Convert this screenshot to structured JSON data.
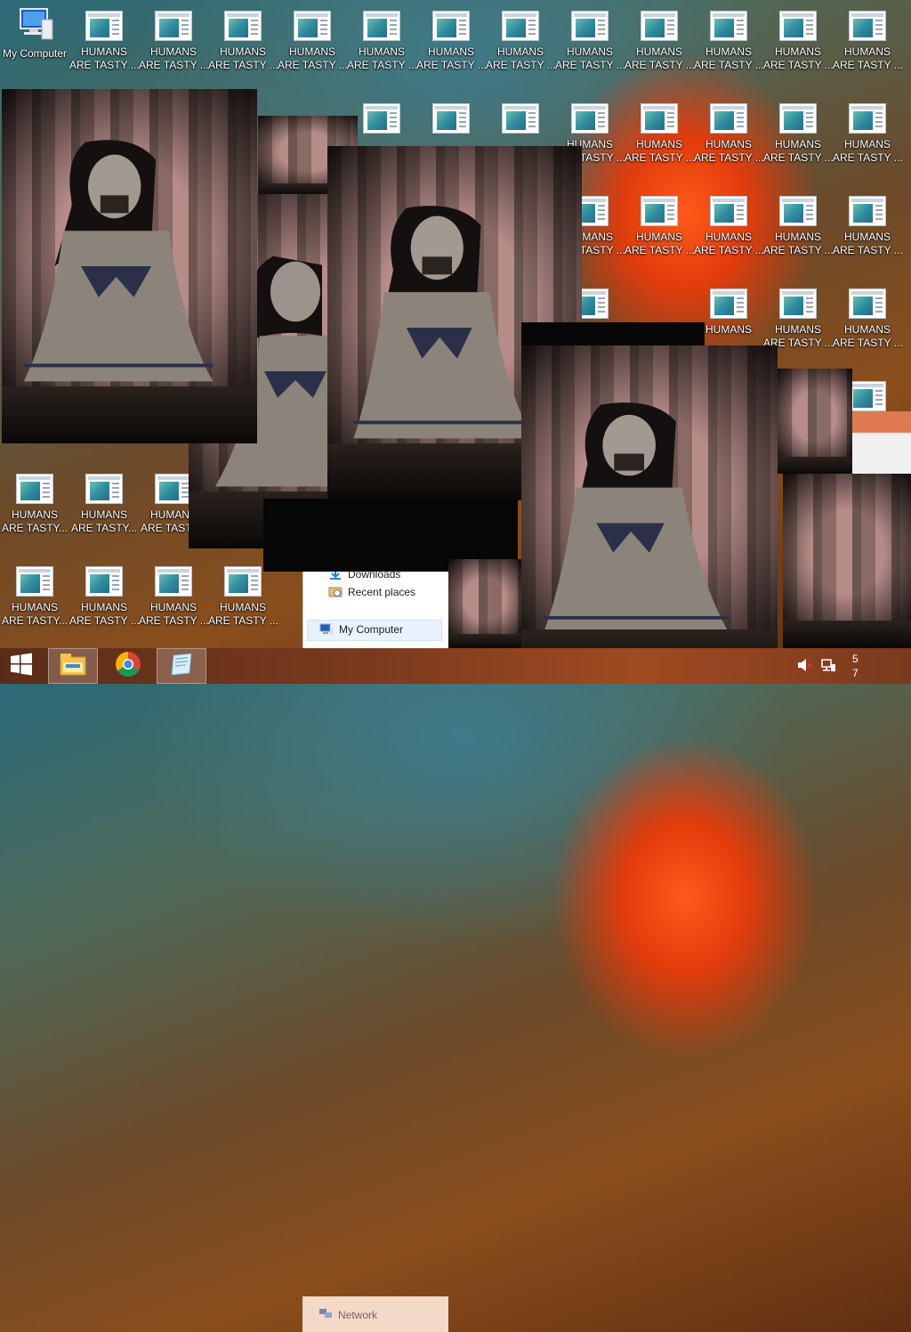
{
  "desktop": {
    "my_computer_label": "My Computer",
    "icon_label_line1": "HUMANS",
    "icon_label_line2": "ARE TASTY ...",
    "icon_label_line2_short": "ARE TASTY..."
  },
  "explorer": {
    "items": [
      {
        "label": "Downloads"
      },
      {
        "label": "Recent places"
      },
      {
        "label": "My Computer"
      },
      {
        "label": "Network"
      }
    ]
  },
  "taskbar": {
    "start_icon": "windows-logo-icon",
    "buttons": [
      {
        "name": "file-explorer-icon"
      },
      {
        "name": "chrome-icon"
      },
      {
        "name": "notepad-icon"
      }
    ],
    "clock_line1": "5",
    "clock_line2": "7"
  },
  "colors": {
    "accent": "#e23c0c",
    "taskbar": "#7a3a1e"
  }
}
